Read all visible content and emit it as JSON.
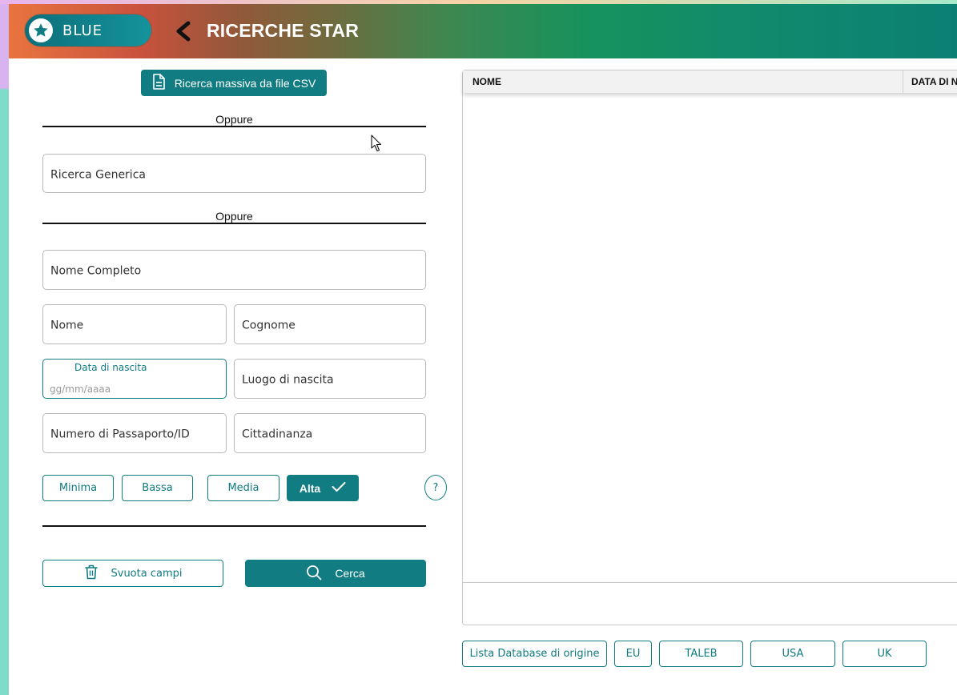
{
  "header": {
    "brand": "BLUE",
    "title": "RICERCHE STAR"
  },
  "csv_button": "Ricerca massiva da file CSV",
  "separator_text": "Oppure",
  "fields": {
    "generic": "Ricerca Generica",
    "full_name": "Nome Completo",
    "first_name": "Nome",
    "last_name": "Cognome",
    "birth_date_label": "Data di nascita",
    "birth_date_placeholder": "gg/mm/aaaa",
    "birth_place": "Luogo di nascita",
    "passport": "Numero di Passaporto/ID",
    "citizenship": "Cittadinanza"
  },
  "match_levels": {
    "options": [
      "Minima",
      "Bassa",
      "Media",
      "Alta"
    ],
    "selected": "Alta",
    "help": "?"
  },
  "actions": {
    "clear": "Svuota campi",
    "search": "Cerca"
  },
  "results_table": {
    "columns": [
      "NOME",
      "DATA DI N"
    ],
    "rows": []
  },
  "databases": {
    "list_label": "Lista Database di origine",
    "items": [
      "EU",
      "TALEB",
      "USA",
      "UK"
    ]
  },
  "colors": {
    "accent": "#117d83",
    "header_gradient_start": "#e9743f",
    "header_gradient_end": "#0c7f73"
  }
}
